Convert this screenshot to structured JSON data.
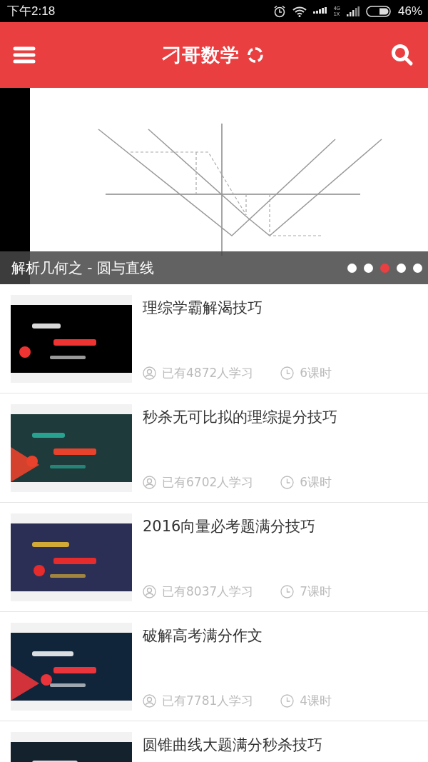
{
  "status_bar": {
    "time": "下午2:18",
    "network": "4G\n1X",
    "battery": "46%"
  },
  "header": {
    "title": "刁哥数学"
  },
  "banner": {
    "caption": "解析几何之 - 圆与直线",
    "dots": [
      {
        "selected": false
      },
      {
        "selected": false
      },
      {
        "selected": true
      },
      {
        "selected": false
      },
      {
        "selected": false
      }
    ]
  },
  "courses": [
    {
      "title": "理综学霸解渴技巧",
      "learners": "已有4872人学习",
      "lessons": "6课时"
    },
    {
      "title": "秒杀无可比拟的理综提分技巧",
      "learners": "已有6702人学习",
      "lessons": "6课时"
    },
    {
      "title": "2016向量必考题满分技巧",
      "learners": "已有8037人学习",
      "lessons": "7课时"
    },
    {
      "title": "破解高考满分作文",
      "learners": "已有7781人学习",
      "lessons": "4课时"
    },
    {
      "title": "圆锥曲线大题满分秒杀技巧"
    }
  ]
}
